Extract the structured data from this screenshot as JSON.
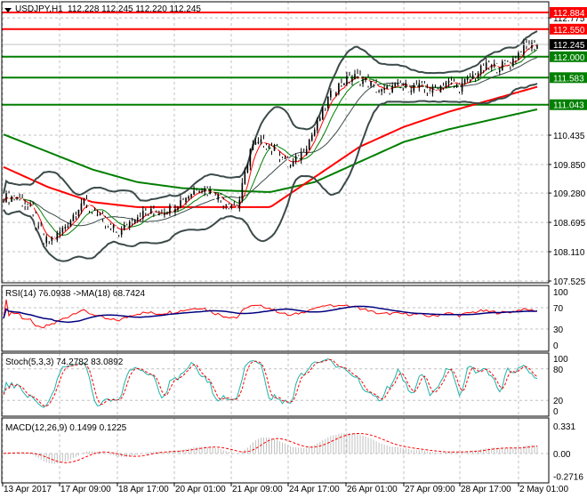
{
  "header": {
    "symbol": "USDJPY,H1",
    "ohlc": "112.228 112.245 112.220 112.245"
  },
  "chart_data": {
    "type": "candlestick",
    "title": "USDJPY,H1 112.228 112.245 112.220 112.245",
    "price_axis_ticks": [
      "112.775",
      "110.435",
      "109.850",
      "109.280",
      "108.695",
      "108.110",
      "107.525"
    ],
    "ylim": [
      107.525,
      112.95
    ],
    "current_price": "112.245",
    "levels": [
      {
        "value": 112.884,
        "label": "112.884",
        "color": "#ff0000"
      },
      {
        "value": 112.55,
        "label": "112.550",
        "color": "#ff0000"
      },
      {
        "value": 112.0,
        "label": "112.000",
        "color": "#007f00"
      },
      {
        "value": 111.583,
        "label": "111.583",
        "color": "#007f00"
      },
      {
        "value": 111.043,
        "label": "111.043",
        "color": "#007f00"
      }
    ],
    "close_path": [
      109.2,
      109.2,
      109.0,
      108.3,
      108.4,
      108.7,
      109.1,
      108.9,
      108.6,
      108.5,
      108.8,
      108.9,
      108.9,
      109.0,
      109.2,
      109.4,
      109.3,
      109.1,
      109.0,
      110.2,
      110.3,
      110.1,
      109.8,
      110.1,
      110.6,
      111.2,
      111.5,
      111.6,
      111.5,
      111.3,
      111.4,
      111.4,
      111.4,
      111.3,
      111.5,
      111.4,
      111.6,
      111.8,
      111.8,
      111.9,
      112.2,
      112.245
    ],
    "ma_slow_red": [
      109.8,
      109.4,
      109.1,
      109.0,
      109.0,
      109.0,
      109.0,
      109.6,
      110.2,
      110.6,
      110.9,
      111.15,
      111.4
    ],
    "ma_slow_green": [
      110.45,
      110.1,
      109.75,
      109.5,
      109.38,
      109.33,
      109.3,
      109.5,
      109.9,
      110.3,
      110.55,
      110.75,
      110.95
    ],
    "time_labels": [
      "13 Apr 2017",
      "17 Apr 09:00",
      "18 Apr 17:00",
      "20 Apr 01:00",
      "21 Apr 09:00",
      "24 Apr 17:00",
      "26 Apr 01:00",
      "27 Apr 09:00",
      "28 Apr 17:00",
      "2 May 01:00"
    ],
    "rsi": {
      "label": "RSI(14) 76.0938  ->MA(18) 68.7424",
      "ticks": [
        "100",
        "70",
        "30",
        "0"
      ],
      "levels": [
        70,
        30
      ]
    },
    "stoch": {
      "label": "Stoch(5,3,3) 74.2782 83.0892",
      "ticks": [
        "100",
        "80",
        "20",
        "0"
      ],
      "levels": [
        80,
        20
      ]
    },
    "macd": {
      "label": "MACD(12,26,9) 0.1499 0.1225",
      "ticks": [
        "0.331",
        "0.00",
        "-0.2716"
      ],
      "ylim": [
        -0.2716,
        0.331
      ]
    }
  },
  "colors": {
    "bull": "#000000",
    "red": "#ff0000",
    "green": "#007f00",
    "band": "#3c4a4a",
    "navy": "#000080",
    "teal": "#20b2aa",
    "hist": "#c0c0c0"
  }
}
